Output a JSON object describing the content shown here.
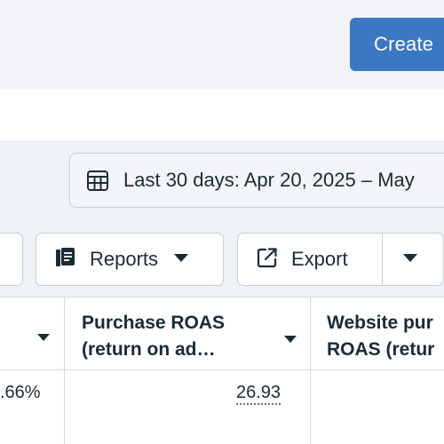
{
  "header": {
    "create_label": "Create"
  },
  "toolbar": {
    "date_range_label": "Last 30 days: Apr 20, 2025 – May",
    "reports_label": "Reports",
    "export_label": "Export"
  },
  "table": {
    "columns": [
      {
        "line1": "Purchase ROAS",
        "line2": "(return on ad…"
      },
      {
        "line1": "Website pur",
        "line2": "ROAS (retur"
      }
    ],
    "row": {
      "prev_cell": ".66%",
      "purchase_roas": "26.93"
    }
  },
  "icons": {
    "calendar": "calendar-icon",
    "reports": "reports-icon",
    "export": "export-icon",
    "caret": "caret-down-icon"
  },
  "colors": {
    "primary": "#3a78c3",
    "text": "#1c2b33",
    "border": "#c8cfd6",
    "background": "#f2f4f7"
  }
}
